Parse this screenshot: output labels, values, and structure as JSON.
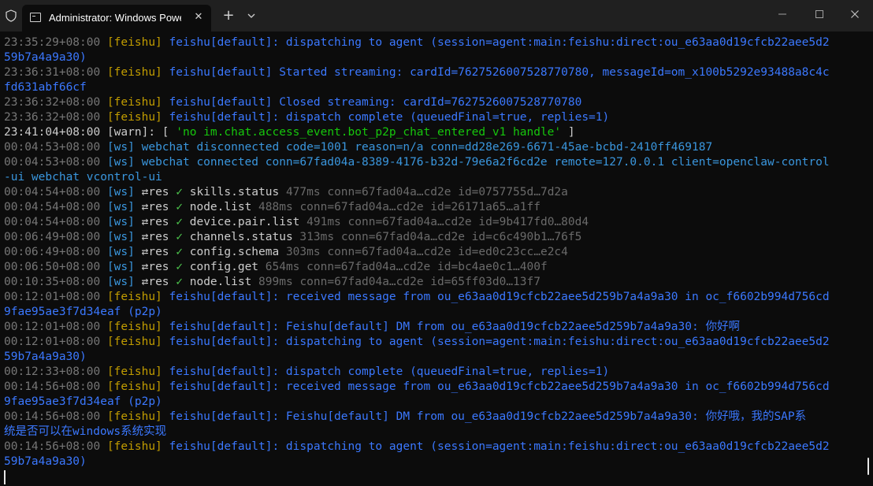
{
  "window": {
    "tab_title": "Administrator: Windows PowerShell",
    "tab_close_icon": "close-icon",
    "new_tab_label": "+",
    "dropdown_icon": "chevron-down-icon",
    "controls": [
      "minimize-icon",
      "maximize-icon",
      "close-icon"
    ]
  },
  "colors": {
    "background": "#0c0c0c",
    "titlebar": "#202020",
    "timestamp": "#767676",
    "timestamp_bright": "#cccccc",
    "tag_feishu": "#c19c00",
    "feishu_text": "#3b78ff",
    "ws_text": "#3a96dd",
    "string_green": "#16c60c",
    "check_green": "#4ec94e",
    "dim": "#6a6a6a"
  },
  "terminal": {
    "lines": [
      [
        {
          "t": "23:35:29+08:00 ",
          "c": "#767676"
        },
        {
          "t": "[feishu] ",
          "c": "#c19c00"
        },
        {
          "t": "feishu[default]: dispatching to agent (session=agent:main:feishu:direct:ou_e63aa0d19cfcb22aee5d2",
          "c": "#3b78ff"
        }
      ],
      [
        {
          "t": "59b7a4a9a30)",
          "c": "#3b78ff"
        }
      ],
      [
        {
          "t": "23:36:31+08:00 ",
          "c": "#767676"
        },
        {
          "t": "[feishu] ",
          "c": "#c19c00"
        },
        {
          "t": "feishu[default] Started streaming: cardId=7627526007528770780, messageId=om_x100b5292e93488a8c4c",
          "c": "#3b78ff"
        }
      ],
      [
        {
          "t": "fd631abf66cf",
          "c": "#3b78ff"
        }
      ],
      [
        {
          "t": "23:36:32+08:00 ",
          "c": "#767676"
        },
        {
          "t": "[feishu] ",
          "c": "#c19c00"
        },
        {
          "t": "feishu[default] Closed streaming: cardId=7627526007528770780",
          "c": "#3b78ff"
        }
      ],
      [
        {
          "t": "23:36:32+08:00 ",
          "c": "#767676"
        },
        {
          "t": "[feishu] ",
          "c": "#c19c00"
        },
        {
          "t": "feishu[default]: dispatch complete (queuedFinal=true, replies=1)",
          "c": "#3b78ff"
        }
      ],
      [
        {
          "t": "23:41:04+08:00 ",
          "c": "#cccccc"
        },
        {
          "t": "[warn]",
          "c": "#cccccc"
        },
        {
          "t": ": [ ",
          "c": "#cccccc"
        },
        {
          "t": "'no im.chat.access_event.bot_p2p_chat_entered_v1 handle'",
          "c": "#16c60c"
        },
        {
          "t": " ]",
          "c": "#cccccc"
        }
      ],
      [
        {
          "t": "00:04:53+08:00 ",
          "c": "#767676"
        },
        {
          "t": "[ws] ",
          "c": "#3a96dd"
        },
        {
          "t": "webchat disconnected code=1001 reason=n/a conn=dd28e269-6671-45ae-bcbd-2410ff469187",
          "c": "#3a96dd"
        }
      ],
      [
        {
          "t": "00:04:53+08:00 ",
          "c": "#767676"
        },
        {
          "t": "[ws] ",
          "c": "#3a96dd"
        },
        {
          "t": "webchat connected conn=67fad04a-8389-4176-b32d-79e6a2f6cd2e remote=127.0.0.1 client=openclaw-control",
          "c": "#3a96dd"
        }
      ],
      [
        {
          "t": "-ui webchat vcontrol-ui",
          "c": "#3a96dd"
        }
      ],
      [
        {
          "t": "00:04:54+08:00 ",
          "c": "#767676"
        },
        {
          "t": "[ws] ",
          "c": "#3a96dd"
        },
        {
          "t": "⇄res ",
          "c": "#cccccc"
        },
        {
          "t": "✓ ",
          "c": "#4ec94e"
        },
        {
          "t": "skills.status ",
          "c": "#cccccc"
        },
        {
          "t": "477ms ",
          "c": "#6a6a6a"
        },
        {
          "t": "conn=67fad04a…cd2e id=0757755d…7d2a",
          "c": "#6a6a6a"
        }
      ],
      [
        {
          "t": "00:04:54+08:00 ",
          "c": "#767676"
        },
        {
          "t": "[ws] ",
          "c": "#3a96dd"
        },
        {
          "t": "⇄res ",
          "c": "#cccccc"
        },
        {
          "t": "✓ ",
          "c": "#4ec94e"
        },
        {
          "t": "node.list ",
          "c": "#cccccc"
        },
        {
          "t": "488ms ",
          "c": "#6a6a6a"
        },
        {
          "t": "conn=67fad04a…cd2e id=26171a65…a1ff",
          "c": "#6a6a6a"
        }
      ],
      [
        {
          "t": "00:04:54+08:00 ",
          "c": "#767676"
        },
        {
          "t": "[ws] ",
          "c": "#3a96dd"
        },
        {
          "t": "⇄res ",
          "c": "#cccccc"
        },
        {
          "t": "✓ ",
          "c": "#4ec94e"
        },
        {
          "t": "device.pair.list ",
          "c": "#cccccc"
        },
        {
          "t": "491ms ",
          "c": "#6a6a6a"
        },
        {
          "t": "conn=67fad04a…cd2e id=9b417fd0…80d4",
          "c": "#6a6a6a"
        }
      ],
      [
        {
          "t": "00:06:49+08:00 ",
          "c": "#767676"
        },
        {
          "t": "[ws] ",
          "c": "#3a96dd"
        },
        {
          "t": "⇄res ",
          "c": "#cccccc"
        },
        {
          "t": "✓ ",
          "c": "#4ec94e"
        },
        {
          "t": "channels.status ",
          "c": "#cccccc"
        },
        {
          "t": "313ms ",
          "c": "#6a6a6a"
        },
        {
          "t": "conn=67fad04a…cd2e id=c6c490b1…76f5",
          "c": "#6a6a6a"
        }
      ],
      [
        {
          "t": "00:06:49+08:00 ",
          "c": "#767676"
        },
        {
          "t": "[ws] ",
          "c": "#3a96dd"
        },
        {
          "t": "⇄res ",
          "c": "#cccccc"
        },
        {
          "t": "✓ ",
          "c": "#4ec94e"
        },
        {
          "t": "config.schema ",
          "c": "#cccccc"
        },
        {
          "t": "303ms ",
          "c": "#6a6a6a"
        },
        {
          "t": "conn=67fad04a…cd2e id=ed0c23cc…e2c4",
          "c": "#6a6a6a"
        }
      ],
      [
        {
          "t": "00:06:50+08:00 ",
          "c": "#767676"
        },
        {
          "t": "[ws] ",
          "c": "#3a96dd"
        },
        {
          "t": "⇄res ",
          "c": "#cccccc"
        },
        {
          "t": "✓ ",
          "c": "#4ec94e"
        },
        {
          "t": "config.get ",
          "c": "#cccccc"
        },
        {
          "t": "654ms ",
          "c": "#6a6a6a"
        },
        {
          "t": "conn=67fad04a…cd2e id=bc4ae0c1…400f",
          "c": "#6a6a6a"
        }
      ],
      [
        {
          "t": "00:10:35+08:00 ",
          "c": "#767676"
        },
        {
          "t": "[ws] ",
          "c": "#3a96dd"
        },
        {
          "t": "⇄res ",
          "c": "#cccccc"
        },
        {
          "t": "✓ ",
          "c": "#4ec94e"
        },
        {
          "t": "node.list ",
          "c": "#cccccc"
        },
        {
          "t": "899ms ",
          "c": "#6a6a6a"
        },
        {
          "t": "conn=67fad04a…cd2e id=65ff03d0…13f7",
          "c": "#6a6a6a"
        }
      ],
      [
        {
          "t": "00:12:01+08:00 ",
          "c": "#767676"
        },
        {
          "t": "[feishu] ",
          "c": "#c19c00"
        },
        {
          "t": "feishu[default]: received message from ou_e63aa0d19cfcb22aee5d259b7a4a9a30 in oc_f6602b994d756cd",
          "c": "#3b78ff"
        }
      ],
      [
        {
          "t": "9fae95ae3f7d34eaf (p2p)",
          "c": "#3b78ff"
        }
      ],
      [
        {
          "t": "00:12:01+08:00 ",
          "c": "#767676"
        },
        {
          "t": "[feishu] ",
          "c": "#c19c00"
        },
        {
          "t": "feishu[default]: Feishu[default] DM from ou_e63aa0d19cfcb22aee5d259b7a4a9a30: 你好啊",
          "c": "#3b78ff"
        }
      ],
      [
        {
          "t": "00:12:01+08:00 ",
          "c": "#767676"
        },
        {
          "t": "[feishu] ",
          "c": "#c19c00"
        },
        {
          "t": "feishu[default]: dispatching to agent (session=agent:main:feishu:direct:ou_e63aa0d19cfcb22aee5d2",
          "c": "#3b78ff"
        }
      ],
      [
        {
          "t": "59b7a4a9a30)",
          "c": "#3b78ff"
        }
      ],
      [
        {
          "t": "00:12:33+08:00 ",
          "c": "#767676"
        },
        {
          "t": "[feishu] ",
          "c": "#c19c00"
        },
        {
          "t": "feishu[default]: dispatch complete (queuedFinal=true, replies=1)",
          "c": "#3b78ff"
        }
      ],
      [
        {
          "t": "00:14:56+08:00 ",
          "c": "#767676"
        },
        {
          "t": "[feishu] ",
          "c": "#c19c00"
        },
        {
          "t": "feishu[default]: received message from ou_e63aa0d19cfcb22aee5d259b7a4a9a30 in oc_f6602b994d756cd",
          "c": "#3b78ff"
        }
      ],
      [
        {
          "t": "9fae95ae3f7d34eaf (p2p)",
          "c": "#3b78ff"
        }
      ],
      [
        {
          "t": "00:14:56+08:00 ",
          "c": "#767676"
        },
        {
          "t": "[feishu] ",
          "c": "#c19c00"
        },
        {
          "t": "feishu[default]: Feishu[default] DM from ou_e63aa0d19cfcb22aee5d259b7a4a9a30: 你好哦，我的SAP系",
          "c": "#3b78ff"
        }
      ],
      [
        {
          "t": "统是否可以在windows系统实现",
          "c": "#3b78ff"
        }
      ],
      [
        {
          "t": "00:14:56+08:00 ",
          "c": "#767676"
        },
        {
          "t": "[feishu] ",
          "c": "#c19c00"
        },
        {
          "t": "feishu[default]: dispatching to agent (session=agent:main:feishu:direct:ou_e63aa0d19cfcb22aee5d2",
          "c": "#3b78ff"
        }
      ],
      [
        {
          "t": "59b7a4a9a30)",
          "c": "#3b78ff"
        }
      ]
    ]
  }
}
